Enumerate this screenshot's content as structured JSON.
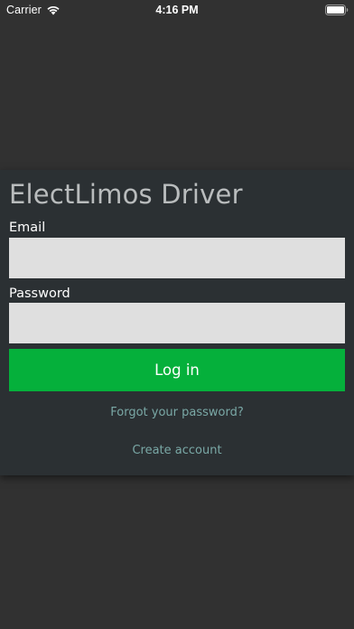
{
  "status_bar": {
    "carrier": "Carrier",
    "time": "4:16 PM",
    "wifi_icon": "wifi-icon",
    "battery_icon": "battery-icon"
  },
  "login": {
    "title": "ElectLimos Driver",
    "email_label": "Email",
    "email_value": "",
    "password_label": "Password",
    "password_value": "",
    "login_button": "Log in",
    "forgot_password": "Forgot your password?",
    "create_account": "Create account"
  },
  "colors": {
    "background": "#313131",
    "card": "#2b3033",
    "input": "#dfdfdf",
    "primary_button": "#05b03b",
    "link": "#7aa8a6"
  }
}
